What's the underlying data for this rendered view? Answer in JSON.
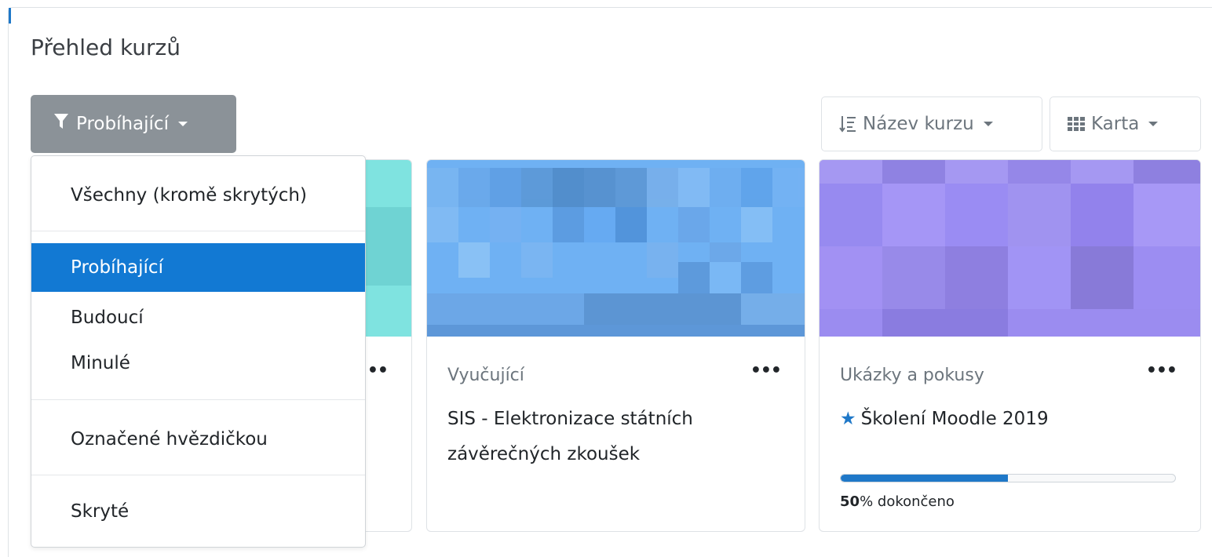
{
  "block": {
    "title": "Přehled kurzů"
  },
  "filter": {
    "label": "Probíhající",
    "icon": "funnel-icon"
  },
  "sort": {
    "label": "Název kurzu",
    "icon": "sort-alpha-icon"
  },
  "view": {
    "label": "Karta",
    "icon": "grid-icon"
  },
  "dropdown": {
    "items": [
      {
        "label": "Všechny (kromě skrytých)"
      },
      {
        "label": "Probíhající",
        "active": true
      },
      {
        "label": "Budoucí"
      },
      {
        "label": "Minulé"
      },
      {
        "label": "Označené hvězdičkou"
      },
      {
        "label": "Skryté"
      }
    ]
  },
  "courses": [
    {
      "category": "",
      "name": "",
      "image_color": "#7fe3e0"
    },
    {
      "category": "Vyučující",
      "name": "SIS - Elektronizace státních závěrečných zkoušek",
      "image_color": "#6fb1f3"
    },
    {
      "category": "Ukázky a pokusy",
      "name": "Školení Moodle 2019",
      "starred": true,
      "progress": {
        "percent": 50,
        "value_text": "50",
        "suffix": "% dokončeno"
      },
      "image_color": "#9d8ef0"
    }
  ],
  "colors": {
    "accent": "#1279d3",
    "filter_button": "#8b9298"
  }
}
